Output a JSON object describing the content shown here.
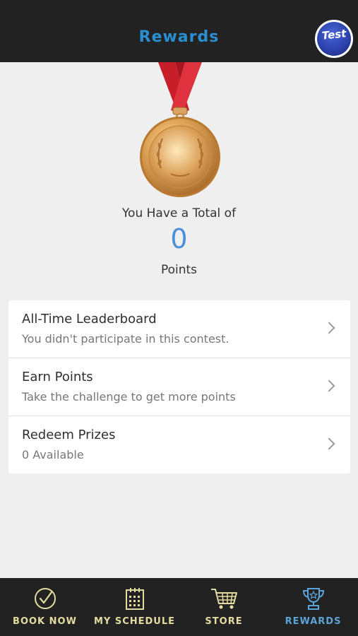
{
  "header": {
    "title": "Rewards",
    "avatar_text": "Test",
    "title_color": "#2a8fd0"
  },
  "summary": {
    "total_label": "You Have a Total of",
    "points_value": "0",
    "points_label": "Points",
    "points_color": "#4a8fd8"
  },
  "menu": [
    {
      "title": "All-Time Leaderboard",
      "subtitle": "You didn't participate in this contest."
    },
    {
      "title": "Earn Points",
      "subtitle": "Take the challenge to get more points"
    },
    {
      "title": "Redeem Prizes",
      "subtitle": "0 Available"
    }
  ],
  "tabbar": {
    "items": [
      {
        "label": "BOOK NOW",
        "icon": "check-circle-icon",
        "active": false
      },
      {
        "label": "MY SCHEDULE",
        "icon": "calendar-icon",
        "active": false
      },
      {
        "label": "STORE",
        "icon": "cart-icon",
        "active": false
      },
      {
        "label": "REWARDS",
        "icon": "trophy-icon",
        "active": true
      }
    ],
    "inactive_color": "#e3dca0",
    "active_color": "#5ba4d8"
  }
}
